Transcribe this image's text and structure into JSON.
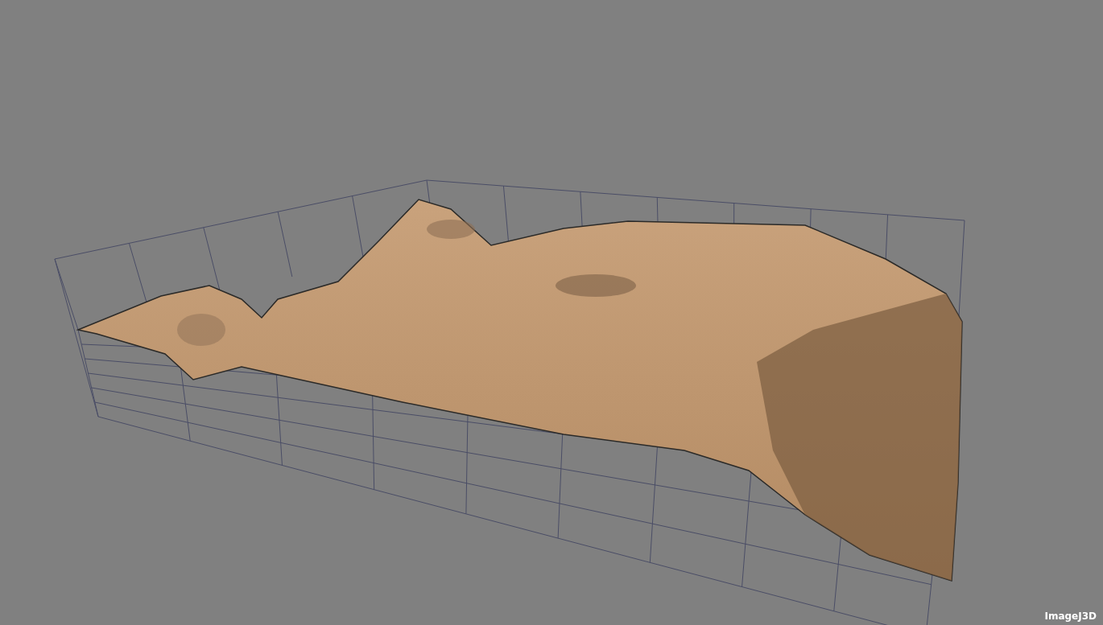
{
  "viewport": {
    "label": "ImageJ3D"
  }
}
